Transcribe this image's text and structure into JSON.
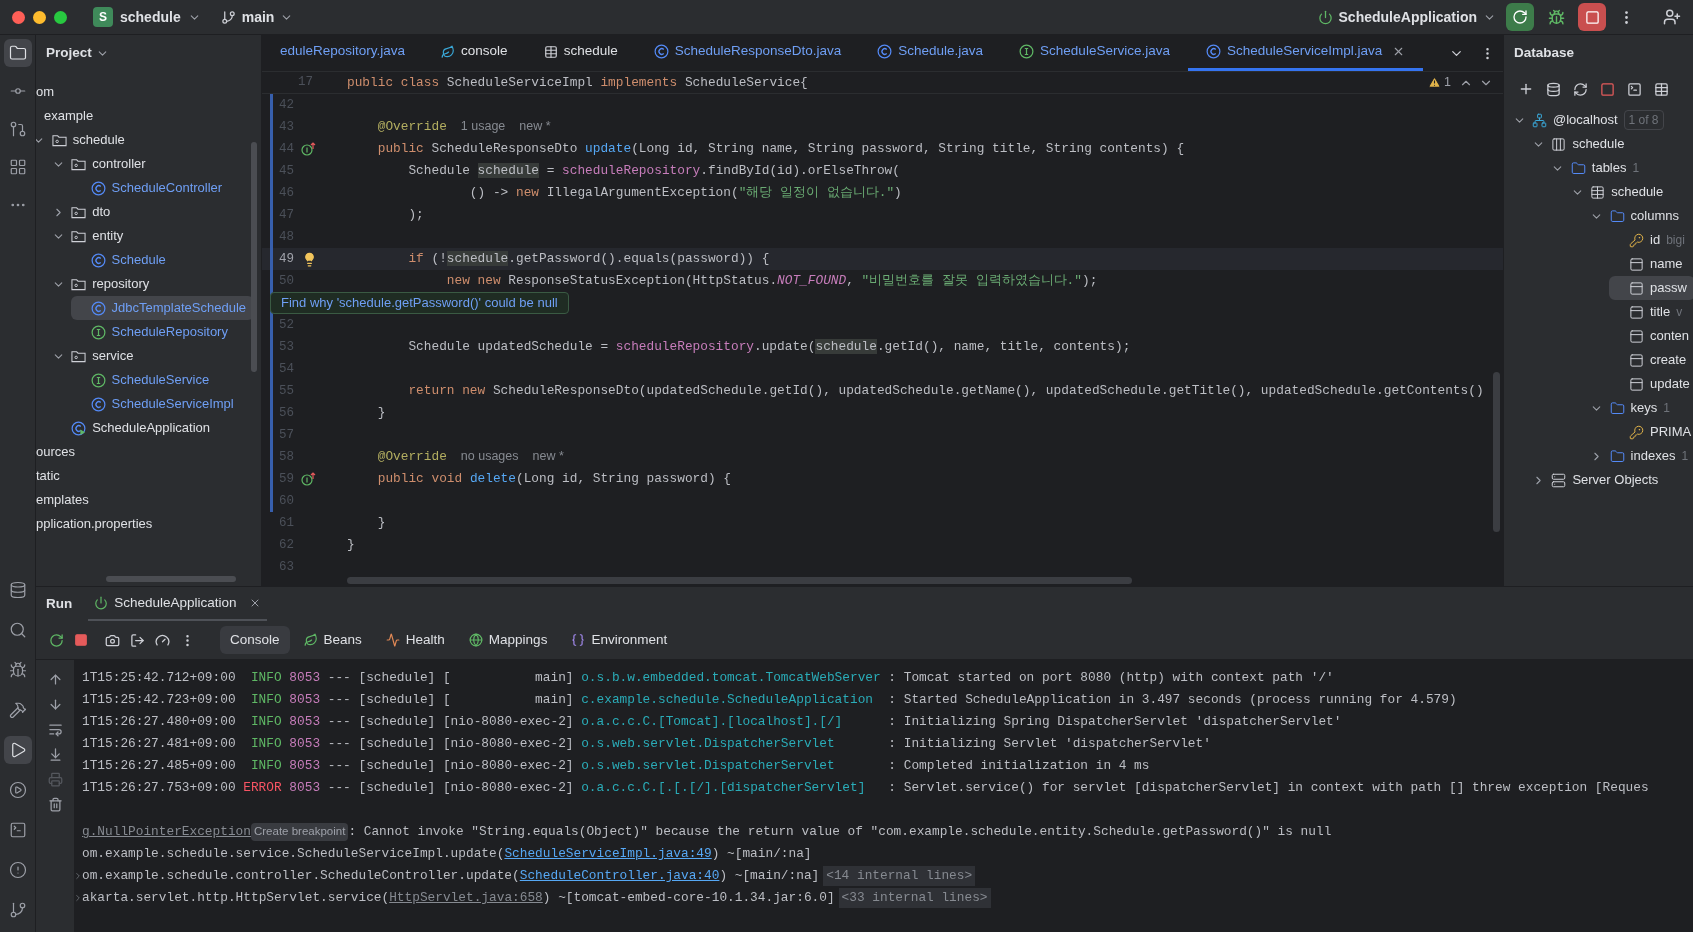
{
  "titlebar": {
    "project_badge": "S",
    "project": "schedule",
    "branch": "main",
    "run_config": "ScheduleApplication"
  },
  "left_toolbar": {
    "top": [
      {
        "kind": "project",
        "selected": true
      },
      {
        "kind": "commit",
        "selected": false
      },
      {
        "kind": "pull-requests",
        "selected": false
      },
      {
        "kind": "structure",
        "selected": false
      },
      {
        "kind": "more",
        "selected": false
      }
    ],
    "bottom": [
      {
        "kind": "database",
        "selected": false
      },
      {
        "kind": "search",
        "selected": false
      },
      {
        "kind": "debug",
        "selected": false
      },
      {
        "kind": "build",
        "selected": false
      },
      {
        "kind": "run",
        "selected": true
      },
      {
        "kind": "services",
        "selected": false
      },
      {
        "kind": "terminal",
        "selected": false
      },
      {
        "kind": "problems",
        "selected": false
      },
      {
        "kind": "git",
        "selected": false
      }
    ]
  },
  "project": {
    "title": "Project",
    "tree": [
      {
        "label": "om",
        "kind": "cut",
        "modified": false,
        "selected": false,
        "children": [
          {
            "label": "example",
            "kind": "cut",
            "modified": false,
            "selected": false,
            "children": [
              {
                "label": "schedule",
                "kind": "package",
                "expanded": true,
                "modified": false,
                "selected": false,
                "children": [
                  {
                    "label": "controller",
                    "kind": "package",
                    "expanded": true,
                    "modified": false,
                    "selected": false,
                    "children": [
                      {
                        "label": "ScheduleController",
                        "kind": "class",
                        "modified": true,
                        "selected": false
                      }
                    ]
                  },
                  {
                    "label": "dto",
                    "kind": "package",
                    "expanded": false,
                    "modified": false,
                    "selected": false
                  },
                  {
                    "label": "entity",
                    "kind": "package",
                    "expanded": true,
                    "modified": false,
                    "selected": false,
                    "children": [
                      {
                        "label": "Schedule",
                        "kind": "class",
                        "modified": true,
                        "selected": false
                      }
                    ]
                  },
                  {
                    "label": "repository",
                    "kind": "package",
                    "expanded": true,
                    "modified": false,
                    "selected": false,
                    "children": [
                      {
                        "label": "JdbcTemplateSchedule",
                        "kind": "class",
                        "modified": true,
                        "selected": true
                      },
                      {
                        "label": "ScheduleRepository",
                        "kind": "interface",
                        "modified": true,
                        "selected": false
                      }
                    ]
                  },
                  {
                    "label": "service",
                    "kind": "package",
                    "expanded": true,
                    "modified": false,
                    "selected": false,
                    "children": [
                      {
                        "label": "ScheduleService",
                        "kind": "interface",
                        "modified": true,
                        "selected": false
                      },
                      {
                        "label": "ScheduleServiceImpl",
                        "kind": "class",
                        "modified": true,
                        "selected": false
                      }
                    ]
                  },
                  {
                    "label": "ScheduleApplication",
                    "kind": "app",
                    "modified": false,
                    "selected": false
                  }
                ]
              }
            ]
          }
        ]
      },
      {
        "label": "ources",
        "kind": "cut",
        "modified": false,
        "selected": false
      },
      {
        "label": "tatic",
        "kind": "cut",
        "modified": false,
        "selected": false
      },
      {
        "label": "emplates",
        "kind": "cut",
        "modified": false,
        "selected": false
      },
      {
        "label": "pplication.properties",
        "kind": "cut",
        "modified": false,
        "selected": false
      }
    ]
  },
  "editor": {
    "tabs": [
      {
        "label": "eduleRepository.java",
        "kind": "cut",
        "modified": true,
        "selected": false
      },
      {
        "label": "console",
        "kind": "console",
        "modified": false,
        "selected": false
      },
      {
        "label": "schedule",
        "kind": "table",
        "modified": false,
        "selected": false
      },
      {
        "label": "ScheduleResponseDto.java",
        "kind": "class",
        "modified": true,
        "selected": false
      },
      {
        "label": "Schedule.java",
        "kind": "class",
        "modified": true,
        "selected": false
      },
      {
        "label": "ScheduleService.java",
        "kind": "interface",
        "modified": true,
        "selected": false
      },
      {
        "label": "ScheduleServiceImpl.java",
        "kind": "class",
        "modified": true,
        "selected": true
      }
    ],
    "sticky": {
      "number": "17",
      "tokens": [
        {
          "kind": "kw",
          "t": "public class "
        },
        {
          "kind": "plain",
          "t": "ScheduleServiceImpl "
        },
        {
          "kind": "kw",
          "t": "implements "
        },
        {
          "kind": "plain",
          "t": "ScheduleService{"
        }
      ]
    },
    "warnings": "1",
    "lines": [
      {
        "number": "42",
        "changed": true,
        "current": false
      },
      {
        "number": "43",
        "changed": true,
        "current": false,
        "tokens": [
          {
            "kind": "ann",
            "t": "    @Override"
          },
          {
            "kind": "hint",
            "t": "1 usage"
          },
          {
            "kind": "hint",
            "t": "new *"
          }
        ]
      },
      {
        "number": "44",
        "changed": true,
        "current": false,
        "gutter": {
          "kind": "implements"
        },
        "tokens": [
          {
            "kind": "kw",
            "t": "    public "
          },
          {
            "kind": "plain",
            "t": "ScheduleResponseDto "
          },
          {
            "kind": "fn",
            "t": "update"
          },
          {
            "kind": "plain",
            "t": "(Long id, String name, String password, String title, String contents) {"
          }
        ]
      },
      {
        "number": "45",
        "changed": true,
        "current": false,
        "tokens": [
          {
            "kind": "plain",
            "t": "        Schedule "
          },
          {
            "kind": "hl",
            "t": "schedule"
          },
          {
            "kind": "plain",
            "t": " = "
          },
          {
            "kind": "field",
            "t": "scheduleRepository"
          },
          {
            "kind": "plain",
            "t": ".findById(id).orElseThrow("
          }
        ]
      },
      {
        "number": "46",
        "changed": true,
        "current": false,
        "tokens": [
          {
            "kind": "plain",
            "t": "                () -> "
          },
          {
            "kind": "kw",
            "t": "new "
          },
          {
            "kind": "plain",
            "t": "IllegalArgumentException("
          },
          {
            "kind": "str",
            "t": "\"해당 일정이 없습니다.\""
          },
          {
            "kind": "plain",
            "t": ")"
          }
        ]
      },
      {
        "number": "47",
        "changed": true,
        "current": false,
        "tokens": [
          {
            "kind": "plain",
            "t": "        );"
          }
        ]
      },
      {
        "number": "48",
        "changed": true,
        "current": false
      },
      {
        "number": "49",
        "changed": true,
        "current": true,
        "gutter": {
          "kind": "bulb"
        },
        "tokens": [
          {
            "kind": "kw",
            "t": "        if "
          },
          {
            "kind": "plain",
            "t": "(!"
          },
          {
            "kind": "hl",
            "t": "schedule"
          },
          {
            "kind": "plain",
            "t": ".getPassword().equals(password)) {"
          }
        ]
      },
      {
        "number": "50",
        "changed": true,
        "current": false,
        "tooltip": "Find why 'schedule.getPassword()' could be null",
        "tokens": [
          {
            "kind": "kw",
            "t": "             new new "
          },
          {
            "kind": "plain",
            "t": "ResponseStatusException(HttpStatus."
          },
          {
            "kind": "const",
            "t": "NOT_FOUND"
          },
          {
            "kind": "plain",
            "t": ", "
          },
          {
            "kind": "str",
            "t": "\"비밀번호를 잘못 입력하였습니다.\""
          },
          {
            "kind": "plain",
            "t": ");"
          }
        ]
      },
      {
        "changed": true,
        "current": false
      },
      {
        "number": "52",
        "changed": true,
        "current": false
      },
      {
        "number": "53",
        "changed": true,
        "current": false,
        "tokens": [
          {
            "kind": "plain",
            "t": "        Schedule updatedSchedule = "
          },
          {
            "kind": "field",
            "t": "scheduleRepository"
          },
          {
            "kind": "plain",
            "t": ".update("
          },
          {
            "kind": "hl",
            "t": "schedule"
          },
          {
            "kind": "plain",
            "t": ".getId(), name, title, contents);"
          }
        ]
      },
      {
        "number": "54",
        "changed": true,
        "current": false
      },
      {
        "number": "55",
        "changed": true,
        "current": false,
        "tokens": [
          {
            "kind": "kw",
            "t": "        return new "
          },
          {
            "kind": "plain",
            "t": "ScheduleResponseDto(updatedSchedule.getId(), updatedSchedule.getName(), updatedSchedule.getTitle(), updatedSchedule.getContents()"
          }
        ]
      },
      {
        "number": "56",
        "changed": true,
        "current": false,
        "tokens": [
          {
            "kind": "plain",
            "t": "    }"
          }
        ]
      },
      {
        "number": "57",
        "changed": true,
        "current": false
      },
      {
        "number": "58",
        "changed": true,
        "current": false,
        "tokens": [
          {
            "kind": "ann",
            "t": "    @Override"
          },
          {
            "kind": "hint",
            "t": "no usages"
          },
          {
            "kind": "hint",
            "t": "new *"
          }
        ]
      },
      {
        "number": "59",
        "changed": true,
        "current": false,
        "gutter": {
          "kind": "implements"
        },
        "tokens": [
          {
            "kind": "kw",
            "t": "    public void "
          },
          {
            "kind": "fn",
            "t": "delete"
          },
          {
            "kind": "plain",
            "t": "(Long id, String password) {"
          }
        ]
      },
      {
        "number": "60",
        "changed": true,
        "current": false
      },
      {
        "number": "61",
        "changed": false,
        "current": false,
        "tokens": [
          {
            "kind": "plain",
            "t": "    }"
          }
        ]
      },
      {
        "number": "62",
        "changed": false,
        "current": false,
        "tokens": [
          {
            "kind": "plain",
            "t": "}"
          }
        ]
      },
      {
        "number": "63",
        "changed": false,
        "current": false
      }
    ]
  },
  "database": {
    "title": "Database",
    "tree": [
      {
        "label": "@localhost",
        "kind": "host",
        "badge": "1 of 8",
        "expanded": true,
        "selected": false,
        "children": [
          {
            "label": "schedule",
            "kind": "schema",
            "expanded": true,
            "selected": false,
            "children": [
              {
                "label": "tables",
                "kind": "folder",
                "count": "1",
                "expanded": true,
                "selected": false,
                "children": [
                  {
                    "label": "schedule",
                    "kind": "table",
                    "expanded": true,
                    "selected": false,
                    "children": [
                      {
                        "label": "columns",
                        "kind": "folder",
                        "expanded": true,
                        "selected": false,
                        "children": [
                          {
                            "label": "id",
                            "kind": "pkcolumn",
                            "type": "bigi",
                            "selected": false
                          },
                          {
                            "label": "name",
                            "kind": "column",
                            "selected": false
                          },
                          {
                            "label": "passw",
                            "kind": "column",
                            "selected": true
                          },
                          {
                            "label": "title",
                            "kind": "column",
                            "type": "v",
                            "selected": false
                          },
                          {
                            "label": "conten",
                            "kind": "column",
                            "selected": false
                          },
                          {
                            "label": "create",
                            "kind": "column",
                            "selected": false
                          },
                          {
                            "label": "update",
                            "kind": "column",
                            "selected": false
                          }
                        ]
                      },
                      {
                        "label": "keys",
                        "kind": "folder",
                        "count": "1",
                        "expanded": true,
                        "selected": false,
                        "children": [
                          {
                            "label": "PRIMA",
                            "kind": "key",
                            "selected": false
                          }
                        ]
                      },
                      {
                        "label": "indexes",
                        "kind": "folder",
                        "count": "1",
                        "expanded": false,
                        "selected": false
                      }
                    ]
                  }
                ]
              }
            ]
          },
          {
            "label": "Server Objects",
            "kind": "server",
            "expanded": false,
            "selected": false
          }
        ]
      }
    ]
  },
  "run": {
    "title": "Run",
    "tab": "ScheduleApplication",
    "tabs": [
      {
        "label": "Console",
        "kind": "console",
        "selected": true
      },
      {
        "label": "Beans",
        "kind": "beans",
        "selected": false
      },
      {
        "label": "Health",
        "kind": "health",
        "selected": false
      },
      {
        "label": "Mappings",
        "kind": "mappings",
        "selected": false
      },
      {
        "label": "Environment",
        "kind": "environment",
        "selected": false
      }
    ],
    "log": [
      {
        "time": "1T15:25:42.712+09:00",
        "level": "INFO",
        "kind": "info",
        "pid": "8053",
        "thread": "--- [schedule] [           main]",
        "logger": "o.s.b.w.embedded.tomcat.TomcatWebServer",
        "message": ": Tomcat started on port 8080 (http) with context path '/'"
      },
      {
        "time": "1T15:25:42.723+09:00",
        "level": "INFO",
        "kind": "info",
        "pid": "8053",
        "thread": "--- [schedule] [           main]",
        "logger": "c.example.schedule.ScheduleApplication",
        "message": ": Started ScheduleApplication in 3.497 seconds (process running for 4.579)"
      },
      {
        "time": "1T15:26:27.480+09:00",
        "level": "INFO",
        "kind": "info",
        "pid": "8053",
        "thread": "--- [schedule] [nio-8080-exec-2]",
        "logger": "o.a.c.c.C.[Tomcat].[localhost].[/]",
        "message": ": Initializing Spring DispatcherServlet 'dispatcherServlet'"
      },
      {
        "time": "1T15:26:27.481+09:00",
        "level": "INFO",
        "kind": "info",
        "pid": "8053",
        "thread": "--- [schedule] [nio-8080-exec-2]",
        "logger": "o.s.web.servlet.DispatcherServlet",
        "message": ": Initializing Servlet 'dispatcherServlet'"
      },
      {
        "time": "1T15:26:27.485+09:00",
        "level": "INFO",
        "kind": "info",
        "pid": "8053",
        "thread": "--- [schedule] [nio-8080-exec-2]",
        "logger": "o.s.web.servlet.DispatcherServlet",
        "message": ": Completed initialization in 4 ms"
      },
      {
        "time": "1T15:26:27.753+09:00",
        "level": "ERROR",
        "kind": "error",
        "pid": "8053",
        "thread": "--- [schedule] [nio-8080-exec-2]",
        "logger": "o.a.c.c.C.[.[.[/].[dispatcherServlet]",
        "message": ": Servlet.service() for servlet [dispatcherServlet] in context with path [] threw exception [Reques"
      }
    ],
    "trace": [
      {
        "foldable": false,
        "tokens": [
          {
            "kind": "exception",
            "t": "g.NullPointerException"
          },
          {
            "kind": "breakpoint",
            "t": "Create breakpoint"
          },
          {
            "kind": "text",
            "t": ": Cannot invoke \"String.equals(Object)\" because the return value of \"com.example.schedule.entity.Schedule.getPassword()\" is null"
          }
        ]
      },
      {
        "foldable": false,
        "tokens": [
          {
            "kind": "text",
            "t": "om.example.schedule.service.ScheduleServiceImpl.update("
          },
          {
            "kind": "link",
            "t": "ScheduleServiceImpl.java:49"
          },
          {
            "kind": "text",
            "t": ") ~[main/:na]"
          }
        ]
      },
      {
        "foldable": true,
        "tokens": [
          {
            "kind": "text",
            "t": "om.example.schedule.controller.ScheduleController.update("
          },
          {
            "kind": "link",
            "t": "ScheduleController.java:40"
          },
          {
            "kind": "text",
            "t": ") ~[main/:na]"
          },
          {
            "kind": "internal",
            "t": "<14 internal lines>"
          }
        ]
      },
      {
        "foldable": true,
        "tokens": [
          {
            "kind": "text",
            "t": "akarta.servlet.http.HttpServlet.service("
          },
          {
            "kind": "liblink",
            "t": "HttpServlet.java:658"
          },
          {
            "kind": "text",
            "t": ") ~[tomcat-embed-core-10.1.34.jar:6.0]"
          },
          {
            "kind": "internal",
            "t": "<33 internal lines>"
          }
        ]
      }
    ]
  }
}
